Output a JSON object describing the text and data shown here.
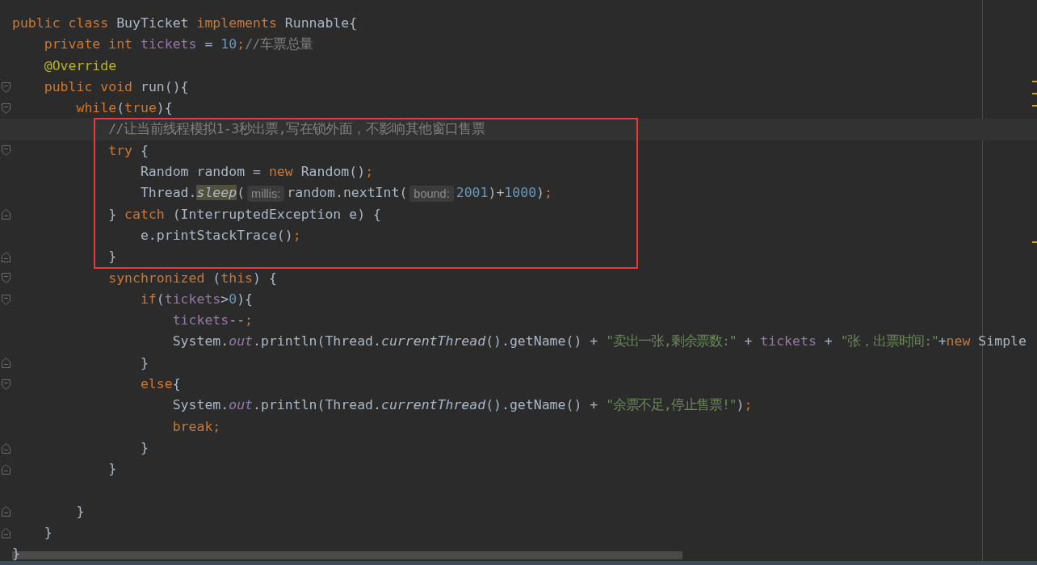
{
  "editor": {
    "blocks": [
      {
        "framed": false,
        "lines": [
          {
            "current": false,
            "tokens": [
              {
                "kind": "keyword",
                "text": "public class "
              },
              {
                "kind": "plain",
                "text": "BuyTicket "
              },
              {
                "kind": "keyword",
                "text": "implements "
              },
              {
                "kind": "plain",
                "text": "Runnable{"
              }
            ]
          },
          {
            "current": false,
            "tokens": [
              {
                "kind": "keyword",
                "text": "    private int "
              },
              {
                "kind": "field",
                "text": "tickets"
              },
              {
                "kind": "plain",
                "text": " = "
              },
              {
                "kind": "number",
                "text": "10"
              },
              {
                "kind": "keyword",
                "text": ";"
              },
              {
                "kind": "comment",
                "text": "//车票总量"
              }
            ]
          },
          {
            "current": false,
            "tokens": [
              {
                "kind": "annotation",
                "text": "    @Override"
              }
            ]
          },
          {
            "current": false,
            "fold_marker": {
              "kind": "start"
            },
            "tokens": [
              {
                "kind": "keyword",
                "text": "    public void "
              },
              {
                "kind": "plain",
                "text": "run(){"
              }
            ]
          },
          {
            "current": false,
            "fold_marker": {
              "kind": "start"
            },
            "tokens": [
              {
                "kind": "keyword",
                "text": "        while"
              },
              {
                "kind": "plain",
                "text": "("
              },
              {
                "kind": "keyword",
                "text": "true"
              },
              {
                "kind": "plain",
                "text": "){"
              }
            ]
          }
        ]
      },
      {
        "framed": true,
        "lines": [
          {
            "current": true,
            "tokens": [
              {
                "kind": "comment",
                "text": "            //让当前线程模拟1-3秒出票,写在锁外面，不影响其他窗口售票"
              }
            ]
          },
          {
            "current": false,
            "fold_marker": {
              "kind": "start"
            },
            "tokens": [
              {
                "kind": "keyword",
                "text": "            try "
              },
              {
                "kind": "plain",
                "text": "{"
              }
            ]
          },
          {
            "current": false,
            "tokens": [
              {
                "kind": "plain",
                "text": "                Random random = "
              },
              {
                "kind": "keyword",
                "text": "new "
              },
              {
                "kind": "plain",
                "text": "Random()"
              },
              {
                "kind": "keyword",
                "text": ";"
              }
            ]
          },
          {
            "current": false,
            "tokens": [
              {
                "kind": "plain",
                "text": "                Thread."
              },
              {
                "kind": "usage",
                "text": "sleep"
              },
              {
                "kind": "plain",
                "text": "("
              },
              {
                "kind": "hint",
                "text": "millis:"
              },
              {
                "kind": "plain",
                "text": "random.nextInt("
              },
              {
                "kind": "hint",
                "text": "bound:"
              },
              {
                "kind": "number",
                "text": "2001"
              },
              {
                "kind": "plain",
                "text": ")+"
              },
              {
                "kind": "number",
                "text": "1000"
              },
              {
                "kind": "plain",
                "text": ")"
              },
              {
                "kind": "keyword",
                "text": ";"
              }
            ]
          },
          {
            "current": false,
            "fold_marker": {
              "kind": "end"
            },
            "tokens": [
              {
                "kind": "plain",
                "text": "            } "
              },
              {
                "kind": "keyword",
                "text": "catch "
              },
              {
                "kind": "plain",
                "text": "(InterruptedException e) {"
              }
            ]
          },
          {
            "current": false,
            "tokens": [
              {
                "kind": "plain",
                "text": "                e.printStackTrace()"
              },
              {
                "kind": "keyword",
                "text": ";"
              }
            ]
          },
          {
            "current": false,
            "fold_marker": {
              "kind": "end"
            },
            "tokens": [
              {
                "kind": "plain",
                "text": "            }"
              }
            ]
          }
        ]
      },
      {
        "framed": false,
        "lines": [
          {
            "current": false,
            "fold_marker": {
              "kind": "start"
            },
            "tokens": [
              {
                "kind": "keyword",
                "text": "            synchronized "
              },
              {
                "kind": "plain",
                "text": "("
              },
              {
                "kind": "keyword",
                "text": "this"
              },
              {
                "kind": "plain",
                "text": ") {"
              }
            ]
          },
          {
            "current": false,
            "fold_marker": {
              "kind": "start"
            },
            "tokens": [
              {
                "kind": "keyword",
                "text": "                if"
              },
              {
                "kind": "plain",
                "text": "("
              },
              {
                "kind": "field",
                "text": "tickets"
              },
              {
                "kind": "plain",
                "text": ">"
              },
              {
                "kind": "number",
                "text": "0"
              },
              {
                "kind": "plain",
                "text": "){"
              }
            ]
          },
          {
            "current": false,
            "tokens": [
              {
                "kind": "field",
                "text": "                    tickets"
              },
              {
                "kind": "plain",
                "text": "--"
              },
              {
                "kind": "keyword",
                "text": ";"
              }
            ]
          },
          {
            "current": false,
            "tokens": [
              {
                "kind": "plain",
                "text": "                    System."
              },
              {
                "kind": "static_field",
                "text": "out"
              },
              {
                "kind": "plain",
                "text": ".println(Thread."
              },
              {
                "kind": "static_method",
                "text": "currentThread"
              },
              {
                "kind": "plain",
                "text": "().getName() + "
              },
              {
                "kind": "string",
                "text": "\"卖出一张,剩余票数:\""
              },
              {
                "kind": "plain",
                "text": " + "
              },
              {
                "kind": "field",
                "text": "tickets"
              },
              {
                "kind": "plain",
                "text": " + "
              },
              {
                "kind": "string",
                "text": "\"张，出票时间:\""
              },
              {
                "kind": "plain",
                "text": "+"
              },
              {
                "kind": "keyword",
                "text": "new "
              },
              {
                "kind": "plain",
                "text": "Simple"
              }
            ]
          },
          {
            "current": false,
            "fold_marker": {
              "kind": "end"
            },
            "tokens": [
              {
                "kind": "plain",
                "text": "                }"
              }
            ]
          },
          {
            "current": false,
            "fold_marker": {
              "kind": "start"
            },
            "tokens": [
              {
                "kind": "keyword",
                "text": "                else"
              },
              {
                "kind": "plain",
                "text": "{"
              }
            ]
          },
          {
            "current": false,
            "tokens": [
              {
                "kind": "plain",
                "text": "                    System."
              },
              {
                "kind": "static_field",
                "text": "out"
              },
              {
                "kind": "plain",
                "text": ".println(Thread."
              },
              {
                "kind": "static_method",
                "text": "currentThread"
              },
              {
                "kind": "plain",
                "text": "().getName() + "
              },
              {
                "kind": "string",
                "text": "\"余票不足,停止售票!\""
              },
              {
                "kind": "plain",
                "text": ")"
              },
              {
                "kind": "keyword",
                "text": ";"
              }
            ]
          },
          {
            "current": false,
            "tokens": [
              {
                "kind": "keyword",
                "text": "                    break;"
              }
            ]
          },
          {
            "current": false,
            "fold_marker": {
              "kind": "end"
            },
            "tokens": [
              {
                "kind": "plain",
                "text": "                }"
              }
            ]
          },
          {
            "current": false,
            "fold_marker": {
              "kind": "end"
            },
            "tokens": [
              {
                "kind": "plain",
                "text": "            }"
              }
            ]
          },
          {
            "current": false
          },
          {
            "current": false,
            "fold_marker": {
              "kind": "end"
            },
            "tokens": [
              {
                "kind": "plain",
                "text": "        }"
              }
            ]
          },
          {
            "current": false,
            "fold_marker": {
              "kind": "end"
            },
            "tokens": [
              {
                "kind": "plain",
                "text": "    }"
              }
            ]
          },
          {
            "current": false,
            "tokens": [
              {
                "kind": "plain",
                "text": "}"
              }
            ]
          }
        ]
      }
    ]
  }
}
